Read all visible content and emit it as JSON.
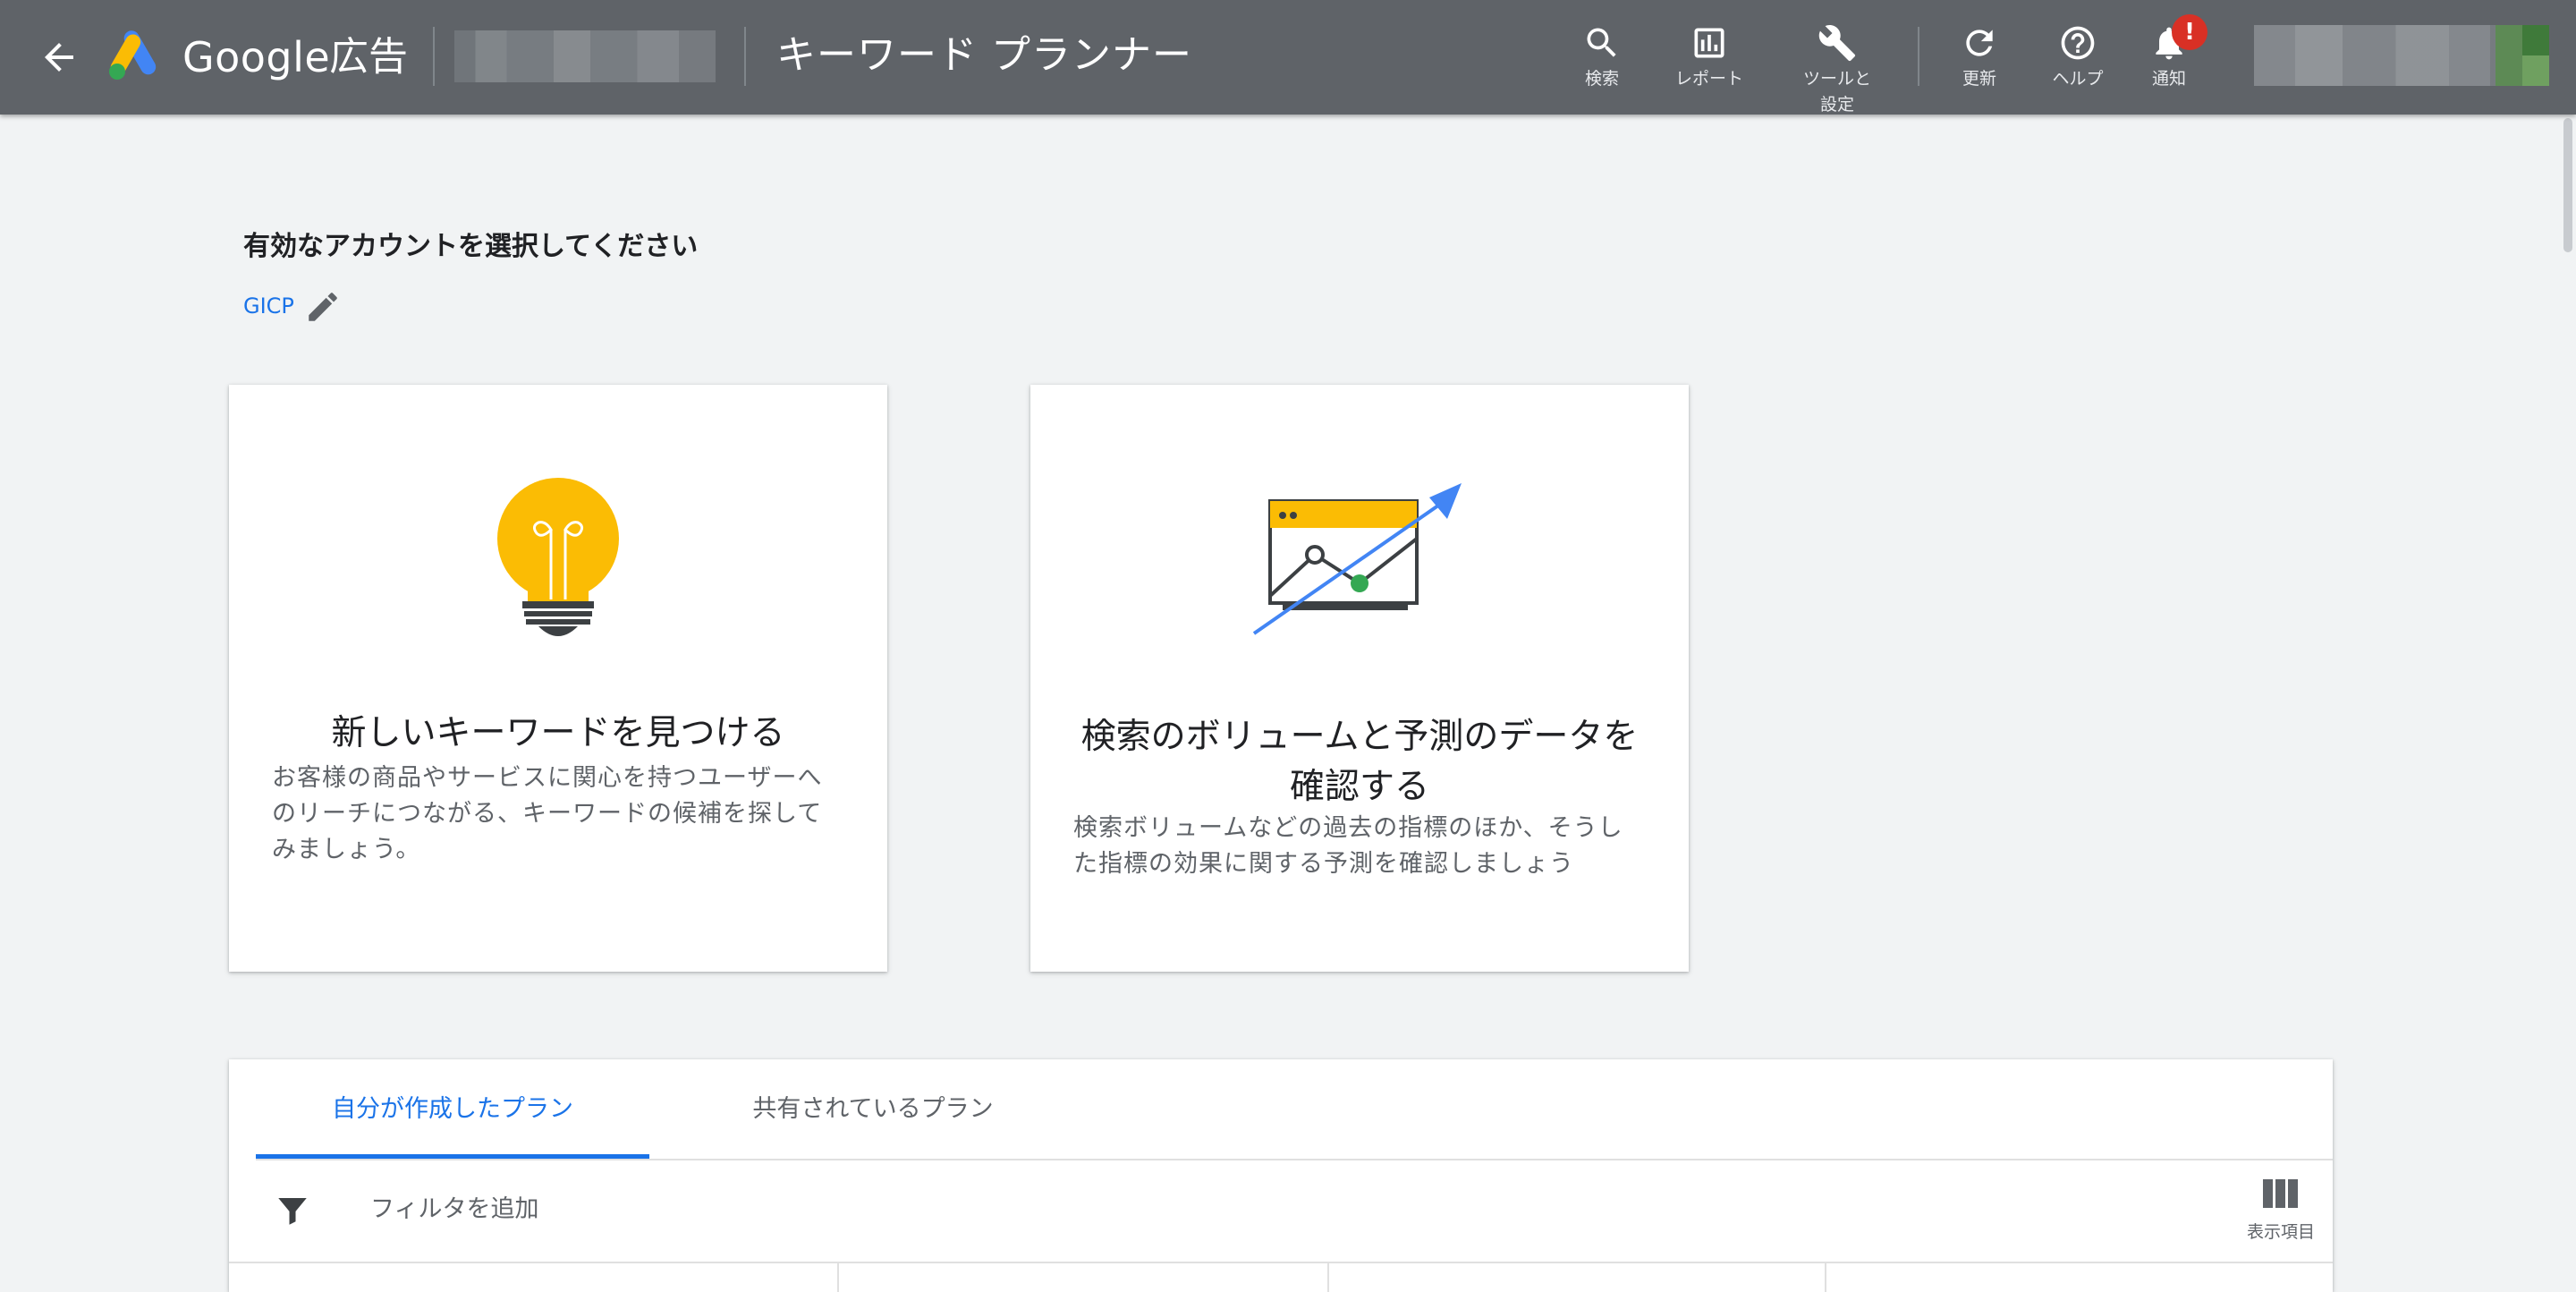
{
  "topbar": {
    "brand_google": "Google",
    "brand_ads": "広告",
    "page_title": "キーワード プランナー",
    "items": [
      {
        "icon": "search-icon",
        "label": "検索"
      },
      {
        "icon": "reports-icon",
        "label": "レポート"
      },
      {
        "icon": "tools-icon",
        "label": "ツールと\n設定"
      },
      {
        "icon": "refresh-icon",
        "label": "更新"
      },
      {
        "icon": "help-icon",
        "label": "ヘルプ"
      },
      {
        "icon": "notifications-icon",
        "label": "通知"
      }
    ],
    "notification_badge": "!",
    "colors": {
      "bar": "#5f6368",
      "badge": "#d93025"
    }
  },
  "account_select": {
    "heading": "有効なアカウントを選択してください",
    "account_name": "GICP"
  },
  "cards": [
    {
      "icon": "lightbulb-icon",
      "title": "新しいキーワードを見つける",
      "description": "お客様の商品やサービスに関心を持つユーザーへのリーチにつながる、キーワードの候補を探してみましょう。"
    },
    {
      "icon": "forecast-chart-icon",
      "title": "検索のボリュームと予測のデータを確認する",
      "description": "検索ボリュームなどの過去の指標のほか、そうした指標の効果に関する予測を確認しましょう"
    }
  ],
  "plans": {
    "tabs": [
      "自分が作成したプラン",
      "共有されているプラン"
    ],
    "active_tab": 0,
    "filter_label": "フィルタを追加",
    "columns_label": "表示項目"
  },
  "colors": {
    "accent": "#1a73e8",
    "background": "#f1f3f4"
  }
}
